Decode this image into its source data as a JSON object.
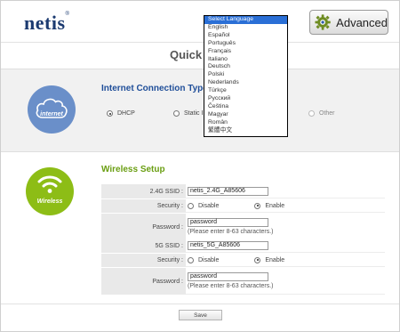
{
  "header": {
    "logo": "netis",
    "logo_mark": "®",
    "advanced_label": "Advanced",
    "page_title": "Quick S"
  },
  "internet": {
    "title": "Internet Connection Type",
    "icon_label": "internet",
    "options": [
      "DHCP",
      "Static IP",
      "Other"
    ],
    "selected": "DHCP"
  },
  "wireless": {
    "title": "Wireless Setup",
    "icon_label": "Wireless",
    "ssid_24_label": "2.4G SSID :",
    "ssid_24_value": "netis_2.4G_A85606",
    "security_label": "Security :",
    "disable_label": "Disable",
    "enable_label": "Enable",
    "password_label": "Password :",
    "password_value": "password",
    "password_hint": "(Please enter 8-63 characters.)",
    "ssid_5_label": "5G SSID :",
    "ssid_5_value": "netis_5G_A85606",
    "security_24": "Enable",
    "security_5": "Enable"
  },
  "save_label": "Save",
  "language_menu": {
    "options": [
      "Select Language",
      "English",
      "Español",
      "Português",
      "Français",
      "Italiano",
      "Deutsch",
      "Polski",
      "Nederlands",
      "Türkçe",
      "Русский",
      "Čeština",
      "Magyar",
      "Român",
      "繁體中文"
    ],
    "selected": "Select Language"
  },
  "colors": {
    "accent_blue": "#1f4e99",
    "accent_green": "#6a9e12",
    "internet_icon_bg": "#6a8fc9",
    "wireless_icon_bg": "#8dbd16",
    "menu_highlight": "#2a6fd6"
  }
}
